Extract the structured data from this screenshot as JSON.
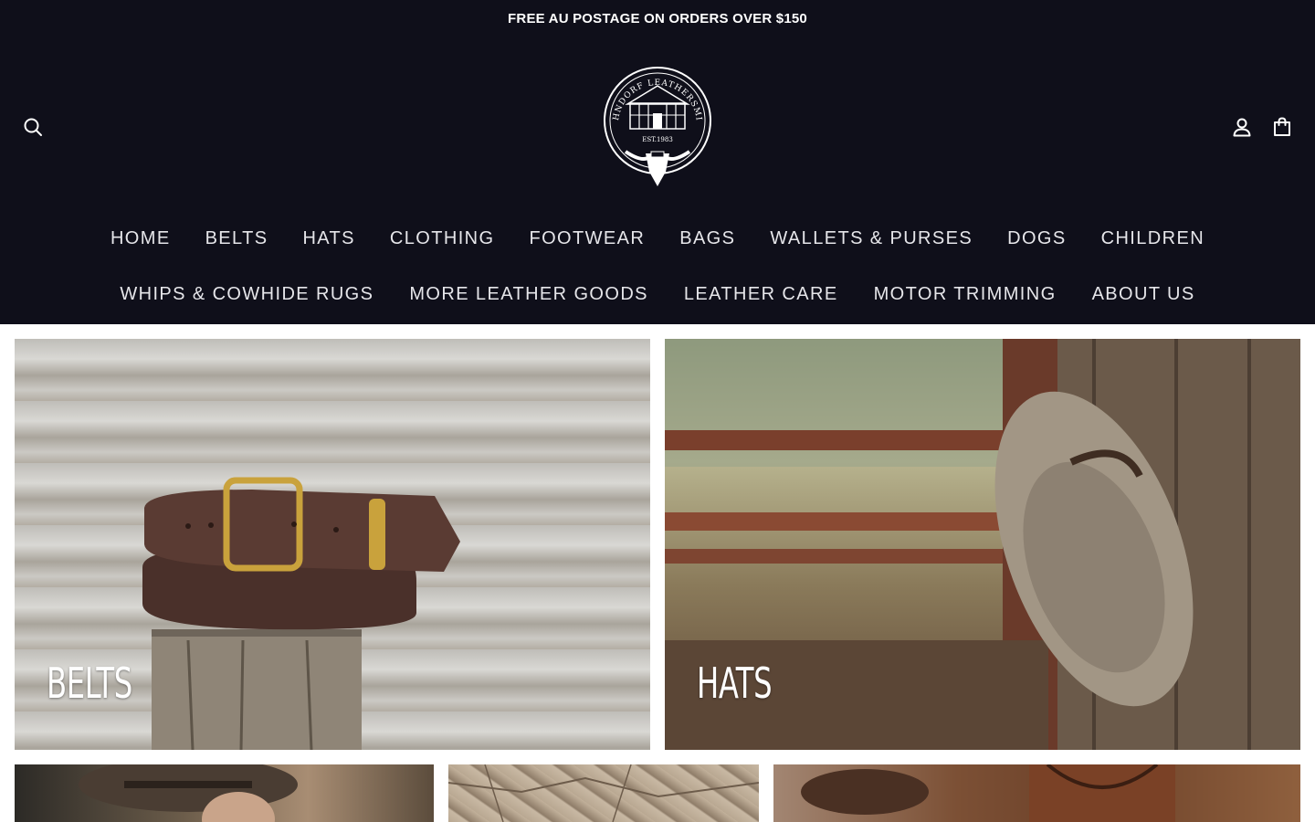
{
  "announcement": "FREE AU POSTAGE ON ORDERS OVER $150",
  "header": {
    "logo": {
      "top_text": "HAHNDORF LEATHERSMITH",
      "established": "EST.1983"
    },
    "icons": {
      "search": "search-icon",
      "account": "user-icon",
      "cart": "shopping-bag-icon"
    }
  },
  "nav": {
    "row1": [
      "HOME",
      "BELTS",
      "HATS",
      "CLOTHING",
      "FOOTWEAR",
      "BAGS",
      "WALLETS & PURSES",
      "DOGS",
      "CHILDREN"
    ],
    "row2": [
      "WHIPS & COWHIDE RUGS",
      "MORE LEATHER GOODS",
      "LEATHER CARE",
      "MOTOR TRIMMING",
      "ABOUT US"
    ]
  },
  "collections": {
    "belts": {
      "label": "BELTS"
    },
    "hats": {
      "label": "HATS"
    }
  },
  "colors": {
    "header_bg": "#0f0f1a",
    "nav_text": "#e6e6ea",
    "announcement_text": "#ffffff"
  }
}
